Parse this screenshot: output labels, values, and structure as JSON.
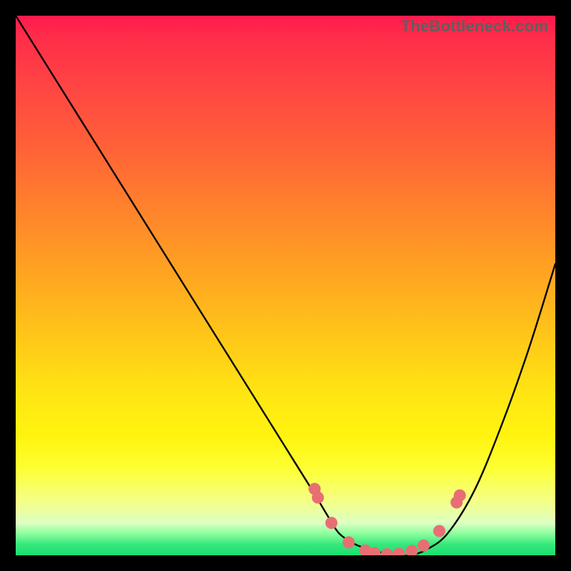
{
  "watermark": "TheBottleneck.com",
  "chart_data": {
    "type": "line",
    "title": "",
    "xlabel": "",
    "ylabel": "",
    "xlim": [
      0,
      100
    ],
    "ylim": [
      0,
      100
    ],
    "grid": false,
    "legend": false,
    "series": [
      {
        "name": "curve",
        "x": [
          0,
          5,
          10,
          15,
          20,
          25,
          30,
          35,
          40,
          45,
          50,
          55,
          58,
          60,
          63,
          66,
          70,
          73,
          76,
          80,
          85,
          90,
          95,
          100
        ],
        "y": [
          100,
          92,
          84,
          76,
          68,
          60,
          52,
          44,
          36,
          28,
          20,
          12,
          7,
          4,
          2,
          1,
          0,
          0,
          1,
          4,
          12,
          24,
          38,
          54
        ]
      }
    ],
    "markers": {
      "name": "highlight-points",
      "color": "#e76f73",
      "x": [
        55.4,
        56.0,
        58.5,
        61.7,
        64.8,
        66.5,
        68.8,
        71.0,
        73.4,
        75.6,
        78.5,
        81.7,
        82.3
      ],
      "y": [
        12.3,
        10.7,
        6.0,
        2.4,
        0.9,
        0.4,
        0.2,
        0.3,
        0.8,
        1.8,
        4.5,
        9.8,
        11.1
      ]
    },
    "background_gradient": {
      "direction": "vertical",
      "stops": [
        {
          "pos": 0.0,
          "color": "#ff1a4d"
        },
        {
          "pos": 0.5,
          "color": "#ffbc1c"
        },
        {
          "pos": 0.85,
          "color": "#fdff34"
        },
        {
          "pos": 0.95,
          "color": "#8bff9e"
        },
        {
          "pos": 1.0,
          "color": "#1adf71"
        }
      ]
    }
  }
}
